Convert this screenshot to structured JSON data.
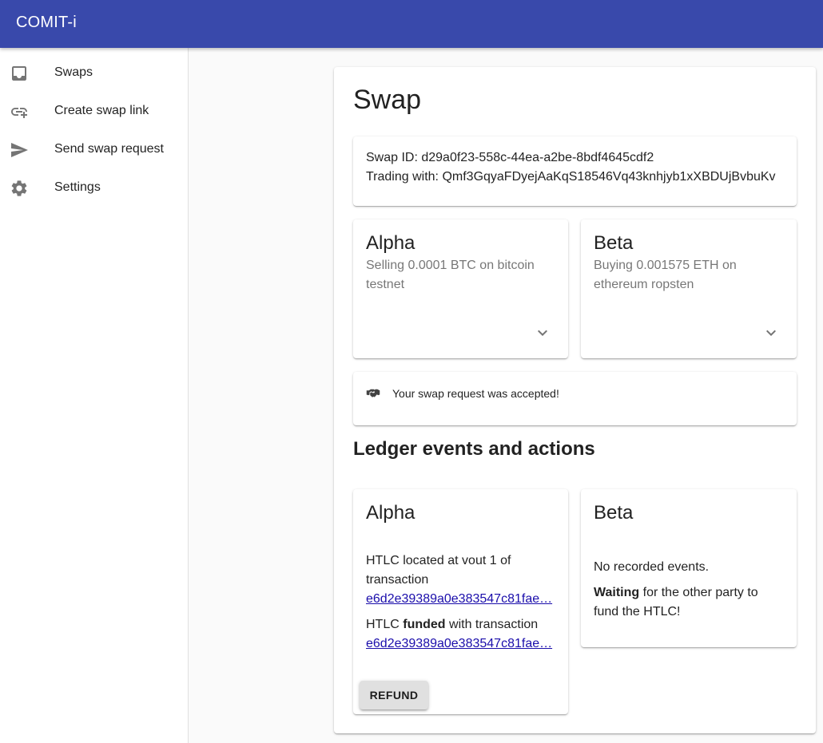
{
  "app": {
    "title": "COMIT-i"
  },
  "sidebar": {
    "items": [
      {
        "label": "Swaps",
        "icon": "inbox-icon"
      },
      {
        "label": "Create swap link",
        "icon": "add-link-icon"
      },
      {
        "label": "Send swap request",
        "icon": "send-icon"
      },
      {
        "label": "Settings",
        "icon": "gear-icon"
      }
    ]
  },
  "swap": {
    "heading": "Swap",
    "id_line": "Swap ID: d29a0f23-558c-44ea-a2be-8bdf4645cdf2",
    "trading_line": "Trading with: Qmf3GqyaFDyejAaKqS18546Vq43knhjyb1xXBDUjBvbuKv",
    "alpha": {
      "title": "Alpha",
      "subtitle": "Selling 0.0001 BTC on bitcoin testnet"
    },
    "beta": {
      "title": "Beta",
      "subtitle": "Buying 0.001575 ETH on ethereum ropsten"
    },
    "status": {
      "icon": "handshake-icon",
      "text": "Your swap request was accepted!"
    }
  },
  "ledger": {
    "heading": "Ledger events and actions",
    "alpha": {
      "title": "Alpha",
      "htlc_located_text": "HTLC located at vout 1 of transaction",
      "htlc_located_tx": "e6d2e39389a0e383547c81fae…",
      "funded_prefix": "HTLC ",
      "funded_bold": "funded",
      "funded_suffix": " with transaction",
      "funded_tx": "e6d2e39389a0e383547c81fae…",
      "refund_label": "REFUND"
    },
    "beta": {
      "title": "Beta",
      "no_events": "No recorded events.",
      "waiting_bold": "Waiting",
      "waiting_rest": " for the other party to fund the HTLC!"
    }
  }
}
